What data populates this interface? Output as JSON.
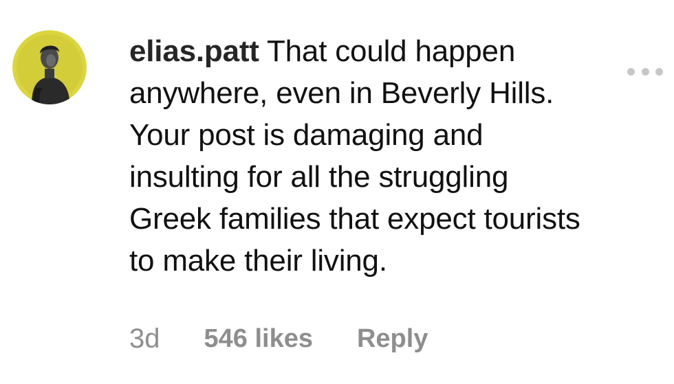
{
  "comment": {
    "username": "elias.patt",
    "text": "That could happen\nanywhere, even in Beverly Hills.\nYour post is damaging and\ninsulting for all the struggling\nGreek families that expect tourists\nto make their living.",
    "time": "3d",
    "likes": "546 likes",
    "reply_label": "Reply"
  },
  "avatar": {
    "ring_color": "#d8d23a"
  },
  "icons": {
    "more": "more-horizontal-icon"
  },
  "colors": {
    "text": "#262626",
    "meta": "#8e8e8e",
    "dots": "#c7c7c7"
  }
}
